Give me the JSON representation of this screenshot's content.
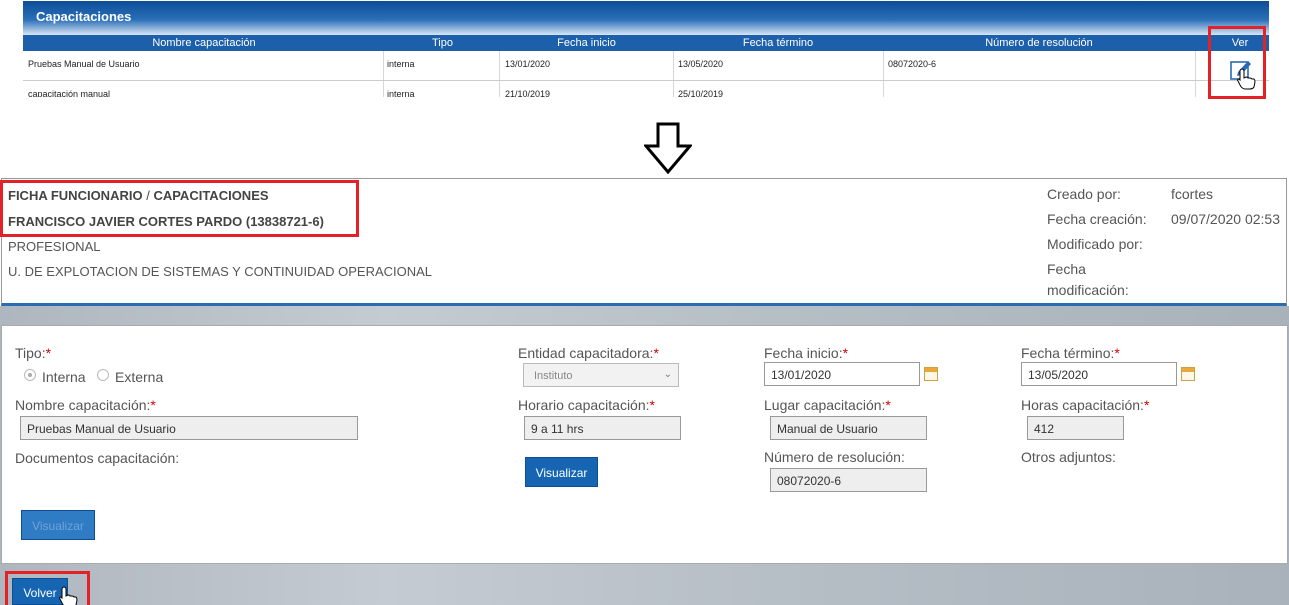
{
  "capacitaciones_table": {
    "title": "Capacitaciones",
    "columns": [
      "Nombre capacitación",
      "Tipo",
      "Fecha inicio",
      "Fecha término",
      "Número de resolución",
      "Ver"
    ],
    "rows": [
      {
        "nombre": "Pruebas Manual de Usuario",
        "tipo": "interna",
        "fecha_inicio": "13/01/2020",
        "fecha_termino": "13/05/2020",
        "resolucion": "08072020-6"
      },
      {
        "nombre": "capacitación manual",
        "tipo": "interna",
        "fecha_inicio": "21/10/2019",
        "fecha_termino": "25/10/2019",
        "resolucion": ""
      }
    ]
  },
  "ficha": {
    "breadcrumb_main": "FICHA FUNCIONARIO",
    "breadcrumb_sep": "/",
    "breadcrumb_sub": "CAPACITACIONES",
    "employee_name": "FRANCISCO JAVIER CORTES PARDO (13838721-6)",
    "role": "PROFESIONAL",
    "unit": "U. DE EXPLOTACION DE SISTEMAS Y CONTINUIDAD OPERACIONAL",
    "meta": {
      "created_by_label": "Creado por:",
      "created_by_value": "fcortes",
      "created_date_label": "Fecha creación:",
      "created_date_value": "09/07/2020 02:53",
      "modified_by_label": "Modificado por:",
      "modified_date_label_1": "Fecha",
      "modified_date_label_2": "modificación:"
    }
  },
  "form": {
    "tipo_label": "Tipo:",
    "tipo_options": [
      "Interna",
      "Externa"
    ],
    "tipo_selected": "Interna",
    "entidad_label": "Entidad capacitadora:",
    "entidad_value": "Instituto",
    "fecha_inicio_label": "Fecha inicio:",
    "fecha_inicio_value": "13/01/2020",
    "fecha_termino_label": "Fecha término:",
    "fecha_termino_value": "13/05/2020",
    "nombre_label": "Nombre capacitación:",
    "nombre_value": "Pruebas Manual de Usuario",
    "horario_label": "Horario capacitación:",
    "horario_value": "9 a 11 hrs",
    "lugar_label": "Lugar capacitación:",
    "lugar_value": "Manual de Usuario",
    "horas_label": "Horas capacitación:",
    "horas_value": "412",
    "documentos_label": "Documentos capacitación:",
    "visualizar_label": "Visualizar",
    "resolucion_label": "Número de resolución:",
    "resolucion_value": "08072020-6",
    "otros_label": "Otros adjuntos:",
    "visualizar2_label": "Visualizar",
    "required_mark": "*"
  },
  "volver_label": "Volver",
  "colors": {
    "primary": "#1565b3",
    "highlight": "#e32228",
    "required": "#d60000"
  }
}
